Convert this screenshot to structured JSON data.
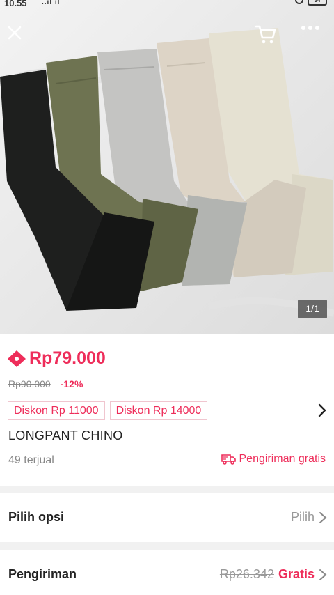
{
  "status_bar": {
    "time": "10.55",
    "signal": "..ıl ıl",
    "battery": "34"
  },
  "image": {
    "counter": "1/1"
  },
  "product": {
    "price": "Rp79.000",
    "original_price": "Rp90.000",
    "discount_percent": "-12%",
    "vouchers": [
      "Diskon Rp 11000",
      "Diskon Rp 14000"
    ],
    "title": "LONGPANT CHINO",
    "sold": "49 terjual",
    "free_shipping": "Pengiriman gratis"
  },
  "options": {
    "label": "Pilih opsi",
    "action": "Pilih"
  },
  "shipping": {
    "label": "Pengiriman",
    "original_cost": "Rp26.342",
    "cost": "Gratis"
  },
  "colors": {
    "accent": "#ee2d5a"
  },
  "icons": [
    "close-icon",
    "cart-icon",
    "more-icon",
    "price-tag-icon",
    "chevron-right-icon",
    "truck-icon"
  ]
}
